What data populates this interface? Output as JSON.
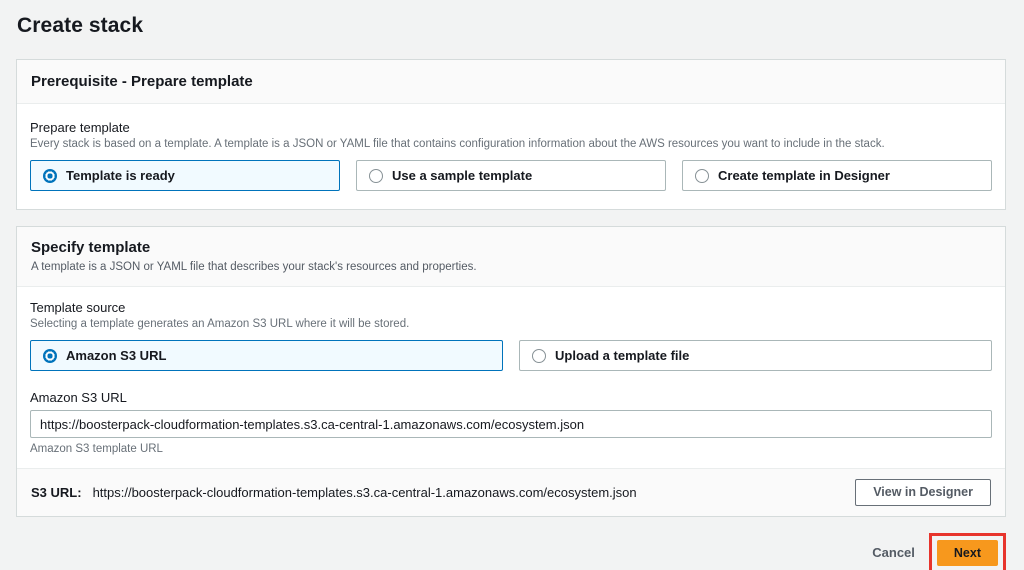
{
  "page": {
    "title": "Create stack"
  },
  "colors": {
    "accent_blue": "#0073bb",
    "selected_tile_bg": "#f1faff",
    "primary_button_orange": "#f7981d",
    "annotation_red": "#e7342c",
    "page_background": "#f2f3f3"
  },
  "prerequisite": {
    "card_title": "Prerequisite - Prepare template",
    "field_label": "Prepare template",
    "field_description": "Every stack is based on a template. A template is a JSON or YAML file that contains configuration information about the AWS resources you want to include in the stack.",
    "options": [
      {
        "label": "Template is ready",
        "selected": true
      },
      {
        "label": "Use a sample template",
        "selected": false
      },
      {
        "label": "Create template in Designer",
        "selected": false
      }
    ]
  },
  "specify": {
    "card_title": "Specify template",
    "card_description": "A template is a JSON or YAML file that describes your stack's resources and properties.",
    "source_label": "Template source",
    "source_description": "Selecting a template generates an Amazon S3 URL where it will be stored.",
    "source_options": [
      {
        "label": "Amazon S3 URL",
        "selected": true
      },
      {
        "label": "Upload a template file",
        "selected": false
      }
    ],
    "url_field_label": "Amazon S3 URL",
    "url_field_value": "https://boosterpack-cloudformation-templates.s3.ca-central-1.amazonaws.com/ecosystem.json",
    "url_field_helper": "Amazon S3 template URL",
    "footer_label": "S3 URL:",
    "footer_url": "https://boosterpack-cloudformation-templates.s3.ca-central-1.amazonaws.com/ecosystem.json",
    "designer_button_label": "View in Designer"
  },
  "actions": {
    "cancel_label": "Cancel",
    "next_label": "Next"
  }
}
